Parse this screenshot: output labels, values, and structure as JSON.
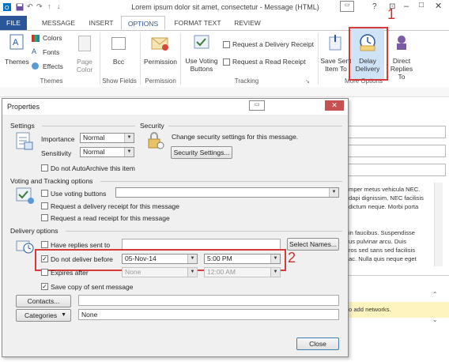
{
  "window": {
    "title": "Lorem ipsum dolor sit amet, consectetur - Message (HTML)"
  },
  "tabs": [
    {
      "label": "FILE"
    },
    {
      "label": "MESSAGE"
    },
    {
      "label": "INSERT"
    },
    {
      "label": "OPTIONS"
    },
    {
      "label": "FORMAT TEXT"
    },
    {
      "label": "REVIEW"
    }
  ],
  "ribbon": {
    "themes": {
      "themes_label": "Themes",
      "colors": "Colors",
      "fonts": "Fonts",
      "effects": "Effects",
      "page_color": "Page Color",
      "group": "Themes"
    },
    "show_fields": {
      "bcc": "Bcc",
      "group": "Show Fields"
    },
    "permission": {
      "label": "Permission",
      "group": "Permission"
    },
    "tracking": {
      "voting": "Use Voting Buttons",
      "delivery_receipt": "Request a Delivery Receipt",
      "read_receipt": "Request a Read Receipt",
      "group": "Tracking"
    },
    "more_options": {
      "save_sent": "Save Sent Item To",
      "delay": "Delay Delivery",
      "direct": "Direct Replies To",
      "group": "More Options"
    }
  },
  "annotations": {
    "one": "1",
    "two": "2"
  },
  "background_text": {
    "lines": [
      "mper metus vehicula NEC.",
      "dapi dignissim, NEC facilisis",
      "dictum neque. Morbi porta",
      "in faucibus. Suspendisse",
      "us pulvinar arcu. Duis",
      "ros sed sans sed facilisis",
      "ac. Nulla quis neque eget"
    ],
    "networks": "o add networks."
  },
  "dialog": {
    "title": "Properties",
    "settings": {
      "heading": "Settings",
      "importance_label": "Importance",
      "importance_value": "Normal",
      "sensitivity_label": "Sensitivity",
      "sensitivity_value": "Normal",
      "no_archive": "Do not AutoArchive this item"
    },
    "security": {
      "heading": "Security",
      "text": "Change security settings for this message.",
      "button": "Security Settings..."
    },
    "voting": {
      "heading": "Voting and Tracking options",
      "use_voting": "Use voting buttons",
      "delivery_receipt": "Request a delivery receipt for this message",
      "read_receipt": "Request a read receipt for this message"
    },
    "delivery": {
      "heading": "Delivery options",
      "replies_sent_to": "Have replies sent to",
      "select_names": "Select Names...",
      "do_not_deliver": "Do not deliver before",
      "deliver_date": "05-Nov-14",
      "deliver_time": "5:00 PM",
      "expires_after": "Expires after",
      "expire_date": "None",
      "expire_time": "12:00 AM",
      "save_copy": "Save copy of sent message"
    },
    "contacts_button": "Contacts...",
    "categories_button": "Categories",
    "categories_value": "None",
    "close_button": "Close"
  }
}
